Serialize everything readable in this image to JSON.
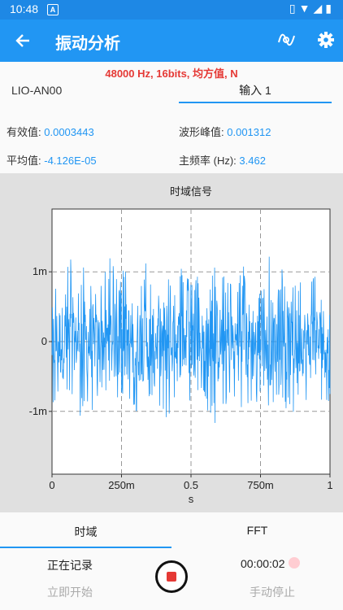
{
  "status_bar": {
    "time": "10:48",
    "badge": "A"
  },
  "app_bar": {
    "title": "振动分析"
  },
  "sample_info": "48000 Hz, 16bits, 均方值, N",
  "device": "LIO-AN00",
  "channel_tab": "输入 1",
  "stats": {
    "rms_label": "有效值:",
    "rms_value": "0.0003443",
    "peak_label": "波形峰值:",
    "peak_value": "0.001312",
    "mean_label": "平均值:",
    "mean_value": "-4.126E-05",
    "freq_label": "主频率 (Hz):",
    "freq_value": "3.462"
  },
  "chart_data": {
    "type": "line",
    "title": "时域信号",
    "xlabel": "s",
    "ylabel": "",
    "xlim": [
      0,
      1
    ],
    "ylim": [
      -0.0019,
      0.0019
    ],
    "x_ticks": [
      0,
      0.25,
      0.5,
      0.75,
      1
    ],
    "x_tick_labels": [
      "0",
      "250m",
      "0.5",
      "750m",
      "1"
    ],
    "y_ticks": [
      0.001,
      0,
      -0.001
    ],
    "y_tick_labels": [
      "1m",
      "0",
      "-1m"
    ],
    "grid": true,
    "series": [
      {
        "color": "#2196f3",
        "envelope_max": [
          0.0009,
          0.00078,
          0.0012,
          0.0008,
          0.0011,
          0.00097,
          0.00076,
          0.001,
          0.0012,
          0.00094,
          0.0013,
          0.0012,
          0.00098,
          0.0012,
          0.00091,
          0.00083,
          0.00104,
          0.0009,
          0.00111,
          0.00093,
          0.00101,
          0.00089,
          0.0008,
          0.0011,
          0.00099,
          0.00094,
          0.00088,
          0.0011,
          0.00102,
          0.0008,
          0.00085,
          0.00125,
          0.0008,
          0.00105,
          0.0009,
          0.00096,
          0.00088,
          0.00109,
          0.00085,
          0.001
        ],
        "envelope_min": [
          -0.0009,
          -0.0012,
          -0.0008,
          -0.0007,
          -0.0011,
          -0.00101,
          -0.0008,
          -0.00092,
          -0.00086,
          -0.0011,
          -0.0008,
          -0.00095,
          -0.0012,
          -0.0009,
          -0.0008,
          -0.00102,
          -0.0012,
          -0.0011,
          -0.0008,
          -0.00093,
          -0.00088,
          -0.0008,
          -0.0011,
          -0.00122,
          -0.0009,
          -0.0009,
          -0.0008,
          -0.00098,
          -0.00115,
          -0.0009,
          -0.0007,
          -0.00105,
          -0.00088,
          -0.00113,
          -0.0012,
          -0.0008,
          -0.00092,
          -0.0009,
          -0.00106,
          -0.0009
        ]
      }
    ]
  },
  "bottom": {
    "tab_time": "时域",
    "tab_fft": "FFT",
    "recording": "正在记录",
    "timer": "00:00:02",
    "start_now": "立即开始",
    "manual_stop": "手动停止"
  },
  "colors": {
    "primary": "#2196f3",
    "status": "#1e88e5",
    "accent_red": "#e53935"
  }
}
